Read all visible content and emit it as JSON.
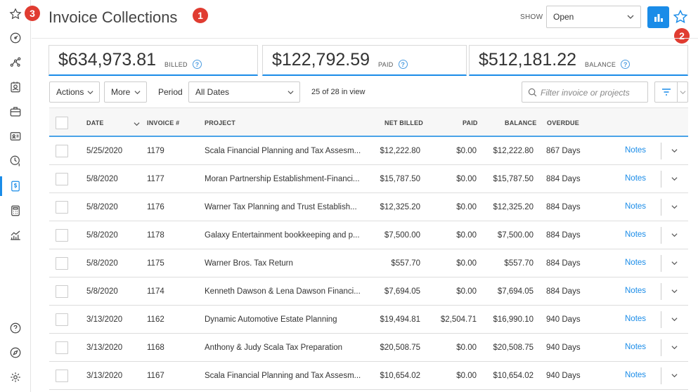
{
  "header": {
    "title": "Invoice Collections",
    "show_label": "SHOW",
    "show_value": "Open"
  },
  "annotations": {
    "badge1": "1",
    "badge2": "2",
    "badge3": "3"
  },
  "sidebar": {
    "items": [
      {
        "icon": "star-icon"
      },
      {
        "icon": "dashboard-icon"
      },
      {
        "icon": "share-nodes-icon"
      },
      {
        "icon": "contact-card-icon"
      },
      {
        "icon": "briefcase-icon"
      },
      {
        "icon": "id-card-icon"
      },
      {
        "icon": "clock-dollar-icon"
      },
      {
        "icon": "invoice-dollar-icon",
        "active": true
      },
      {
        "icon": "calculator-icon"
      },
      {
        "icon": "chart-icon"
      },
      {
        "icon": "help-icon"
      },
      {
        "icon": "compass-icon"
      },
      {
        "icon": "settings-icon"
      }
    ],
    "accent": "#1a8ce8"
  },
  "summary": {
    "billed_amount": "$634,973.81",
    "billed_label": "BILLED",
    "paid_amount": "$122,792.59",
    "paid_label": "PAID",
    "balance_amount": "$512,181.22",
    "balance_label": "BALANCE",
    "help_glyph": "?"
  },
  "toolbar": {
    "actions_label": "Actions",
    "more_label": "More",
    "period_label": "Period",
    "period_value": "All Dates",
    "count_text": "25 of 28 in view",
    "filter_placeholder": "Filter invoice or projects"
  },
  "table": {
    "columns": {
      "date": "DATE",
      "invoice": "INVOICE #",
      "project": "PROJECT",
      "net_billed": "NET BILLED",
      "paid": "PAID",
      "balance": "BALANCE",
      "overdue": "OVERDUE"
    },
    "notes_label": "Notes",
    "rows": [
      {
        "date": "5/25/2020",
        "invoice": "1179",
        "project": "Scala Financial Planning and Tax Assesm...",
        "net_billed": "$12,222.80",
        "paid": "$0.00",
        "balance": "$12,222.80",
        "overdue": "867 Days"
      },
      {
        "date": "5/8/2020",
        "invoice": "1177",
        "project": "Moran Partnership Establishment-Financi...",
        "net_billed": "$15,787.50",
        "paid": "$0.00",
        "balance": "$15,787.50",
        "overdue": "884 Days"
      },
      {
        "date": "5/8/2020",
        "invoice": "1176",
        "project": "Warner Tax Planning and Trust Establish...",
        "net_billed": "$12,325.20",
        "paid": "$0.00",
        "balance": "$12,325.20",
        "overdue": "884 Days"
      },
      {
        "date": "5/8/2020",
        "invoice": "1178",
        "project": "Galaxy Entertainment bookkeeping and p...",
        "net_billed": "$7,500.00",
        "paid": "$0.00",
        "balance": "$7,500.00",
        "overdue": "884 Days"
      },
      {
        "date": "5/8/2020",
        "invoice": "1175",
        "project": "Warner Bros. Tax Return",
        "net_billed": "$557.70",
        "paid": "$0.00",
        "balance": "$557.70",
        "overdue": "884 Days"
      },
      {
        "date": "5/8/2020",
        "invoice": "1174",
        "project": "Kenneth Dawson & Lena Dawson Financi...",
        "net_billed": "$7,694.05",
        "paid": "$0.00",
        "balance": "$7,694.05",
        "overdue": "884 Days"
      },
      {
        "date": "3/13/2020",
        "invoice": "1162",
        "project": "Dynamic Automotive Estate Planning",
        "net_billed": "$19,494.81",
        "paid": "$2,504.71",
        "balance": "$16,990.10",
        "overdue": "940 Days"
      },
      {
        "date": "3/13/2020",
        "invoice": "1168",
        "project": "Anthony & Judy Scala Tax Preparation",
        "net_billed": "$20,508.75",
        "paid": "$0.00",
        "balance": "$20,508.75",
        "overdue": "940 Days"
      },
      {
        "date": "3/13/2020",
        "invoice": "1167",
        "project": "Scala Financial Planning and Tax Assesm...",
        "net_billed": "$10,654.02",
        "paid": "$0.00",
        "balance": "$10,654.02",
        "overdue": "940 Days"
      }
    ]
  }
}
